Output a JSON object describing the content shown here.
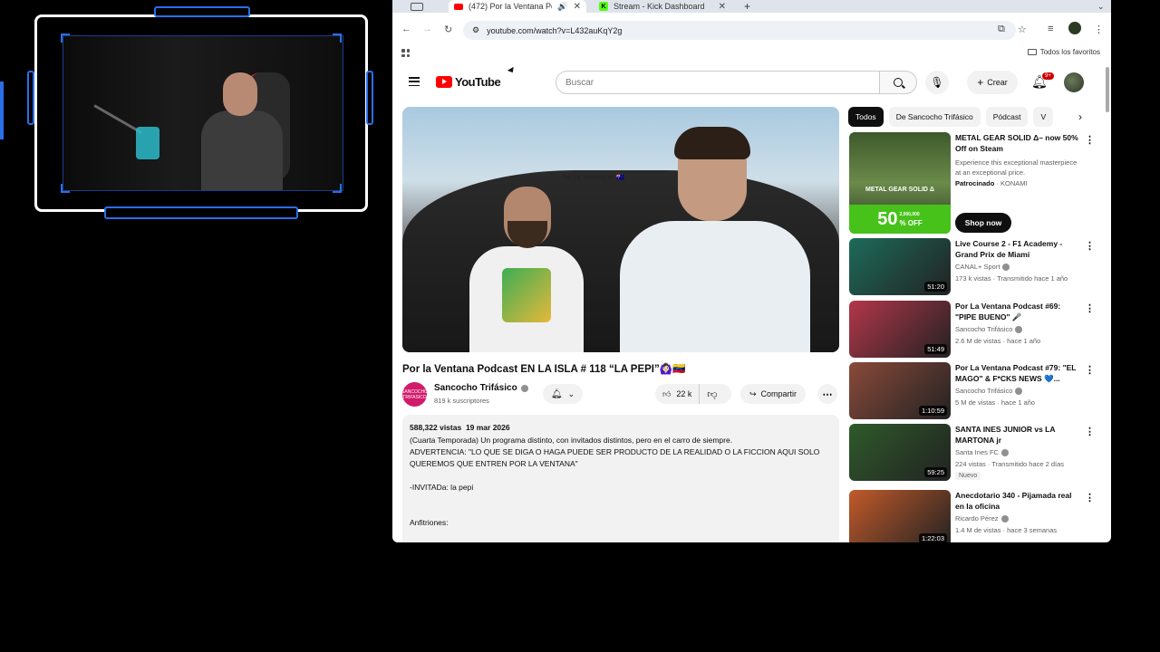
{
  "browser": {
    "tabs": [
      {
        "label": "(472) Por la Ventana Podc",
        "active": true,
        "icon": "youtube-favicon"
      },
      {
        "label": "Stream - Kick Dashboard",
        "active": false,
        "icon": "kick-favicon"
      }
    ],
    "url": "youtube.com/watch?v=L432auKqY2g",
    "bookmarks_folder": "Todos los favoritos"
  },
  "youtube": {
    "logo_text": "YouTube",
    "search_placeholder": "Buscar",
    "create_label": "Crear",
    "notifications_badge": "9+"
  },
  "video": {
    "caption_overlay": "Por La Ventana en 🇦🇺",
    "title": "Por la Ventana Podcast EN LA ISLA # 118 “LA PEPI”🙆🏻‍♀️🇻🇪",
    "channel": {
      "name": "Sancocho Trifásico",
      "subscribers": "819 k suscriptores",
      "avatar_text": "SANCOCHO TRIFASICO"
    },
    "likes": "22 k",
    "share_label": "Compartir",
    "description": {
      "views": "588,322 vistas",
      "date": "19 mar 2026",
      "lines": [
        "(Cuarta Temporada) Un programa distinto, con invitados distintos, pero en el carro de siempre.",
        "ADVERTENCIA: \"LO QUE SE DIGA O HAGA PUEDE SER PRODUCTO DE LA REALIDAD O LA FICCION AQUI SOLO QUEREMOS QUE ENTREN POR LA VENTANA\"",
        "-INVITADa: la pepi",
        "Anfitriones:"
      ]
    }
  },
  "chips": [
    "Todos",
    "De Sancocho Trifásico",
    "Pódcast",
    "V"
  ],
  "ad": {
    "title": "METAL GEAR SOLID Δ– now 50% Off on Steam",
    "description": "Experience this exceptional masterpiece at an exceptional price.",
    "sponsored": "Patrocinado",
    "advertiser": "KONAMI",
    "cta": "Shop now",
    "thumb_logo": "METAL GEAR SOLID Δ",
    "thumb_discount": "50",
    "thumb_pct": "% OFF",
    "thumb_players": "2,000,000"
  },
  "recommendations": [
    {
      "title": "Live Course 2 - F1 Academy - Grand Prix de Miami",
      "channel": "CANAL+ Sport",
      "meta": "173 k vistas · Transmitido hace 1 año",
      "duration": "51:20",
      "color": "#1d6b5a"
    },
    {
      "title": "Por La Ventana Podcast #69: \"PIPE BUENO\" 🎤",
      "channel": "Sancocho Trifásico",
      "meta": "2.6 M de vistas · hace 1 año",
      "duration": "51:49",
      "color": "#b3364a"
    },
    {
      "title": "Por La Ventana Podcast #79: \"EL MAGO\" & F*CKS NEWS 💙...",
      "channel": "Sancocho Trifásico",
      "meta": "5 M de vistas · hace 1 año",
      "duration": "1:10:59",
      "color": "#8a4a3a"
    },
    {
      "title": "SANTA INES JUNIOR vs LA MARTONA jr",
      "channel": "Santa Ines FC",
      "meta": "224 vistas · Transmitido hace 2 días",
      "duration": "59:25",
      "color": "#2e5a2a",
      "badge": "Nuevo"
    },
    {
      "title": "Anecdotario 340 - Pijamada real en la oficina",
      "channel": "Ricardo Pérez",
      "meta": "1.4 M de vistas · hace 3 semanas",
      "duration": "1:22:03",
      "color": "#c25a2a"
    }
  ]
}
